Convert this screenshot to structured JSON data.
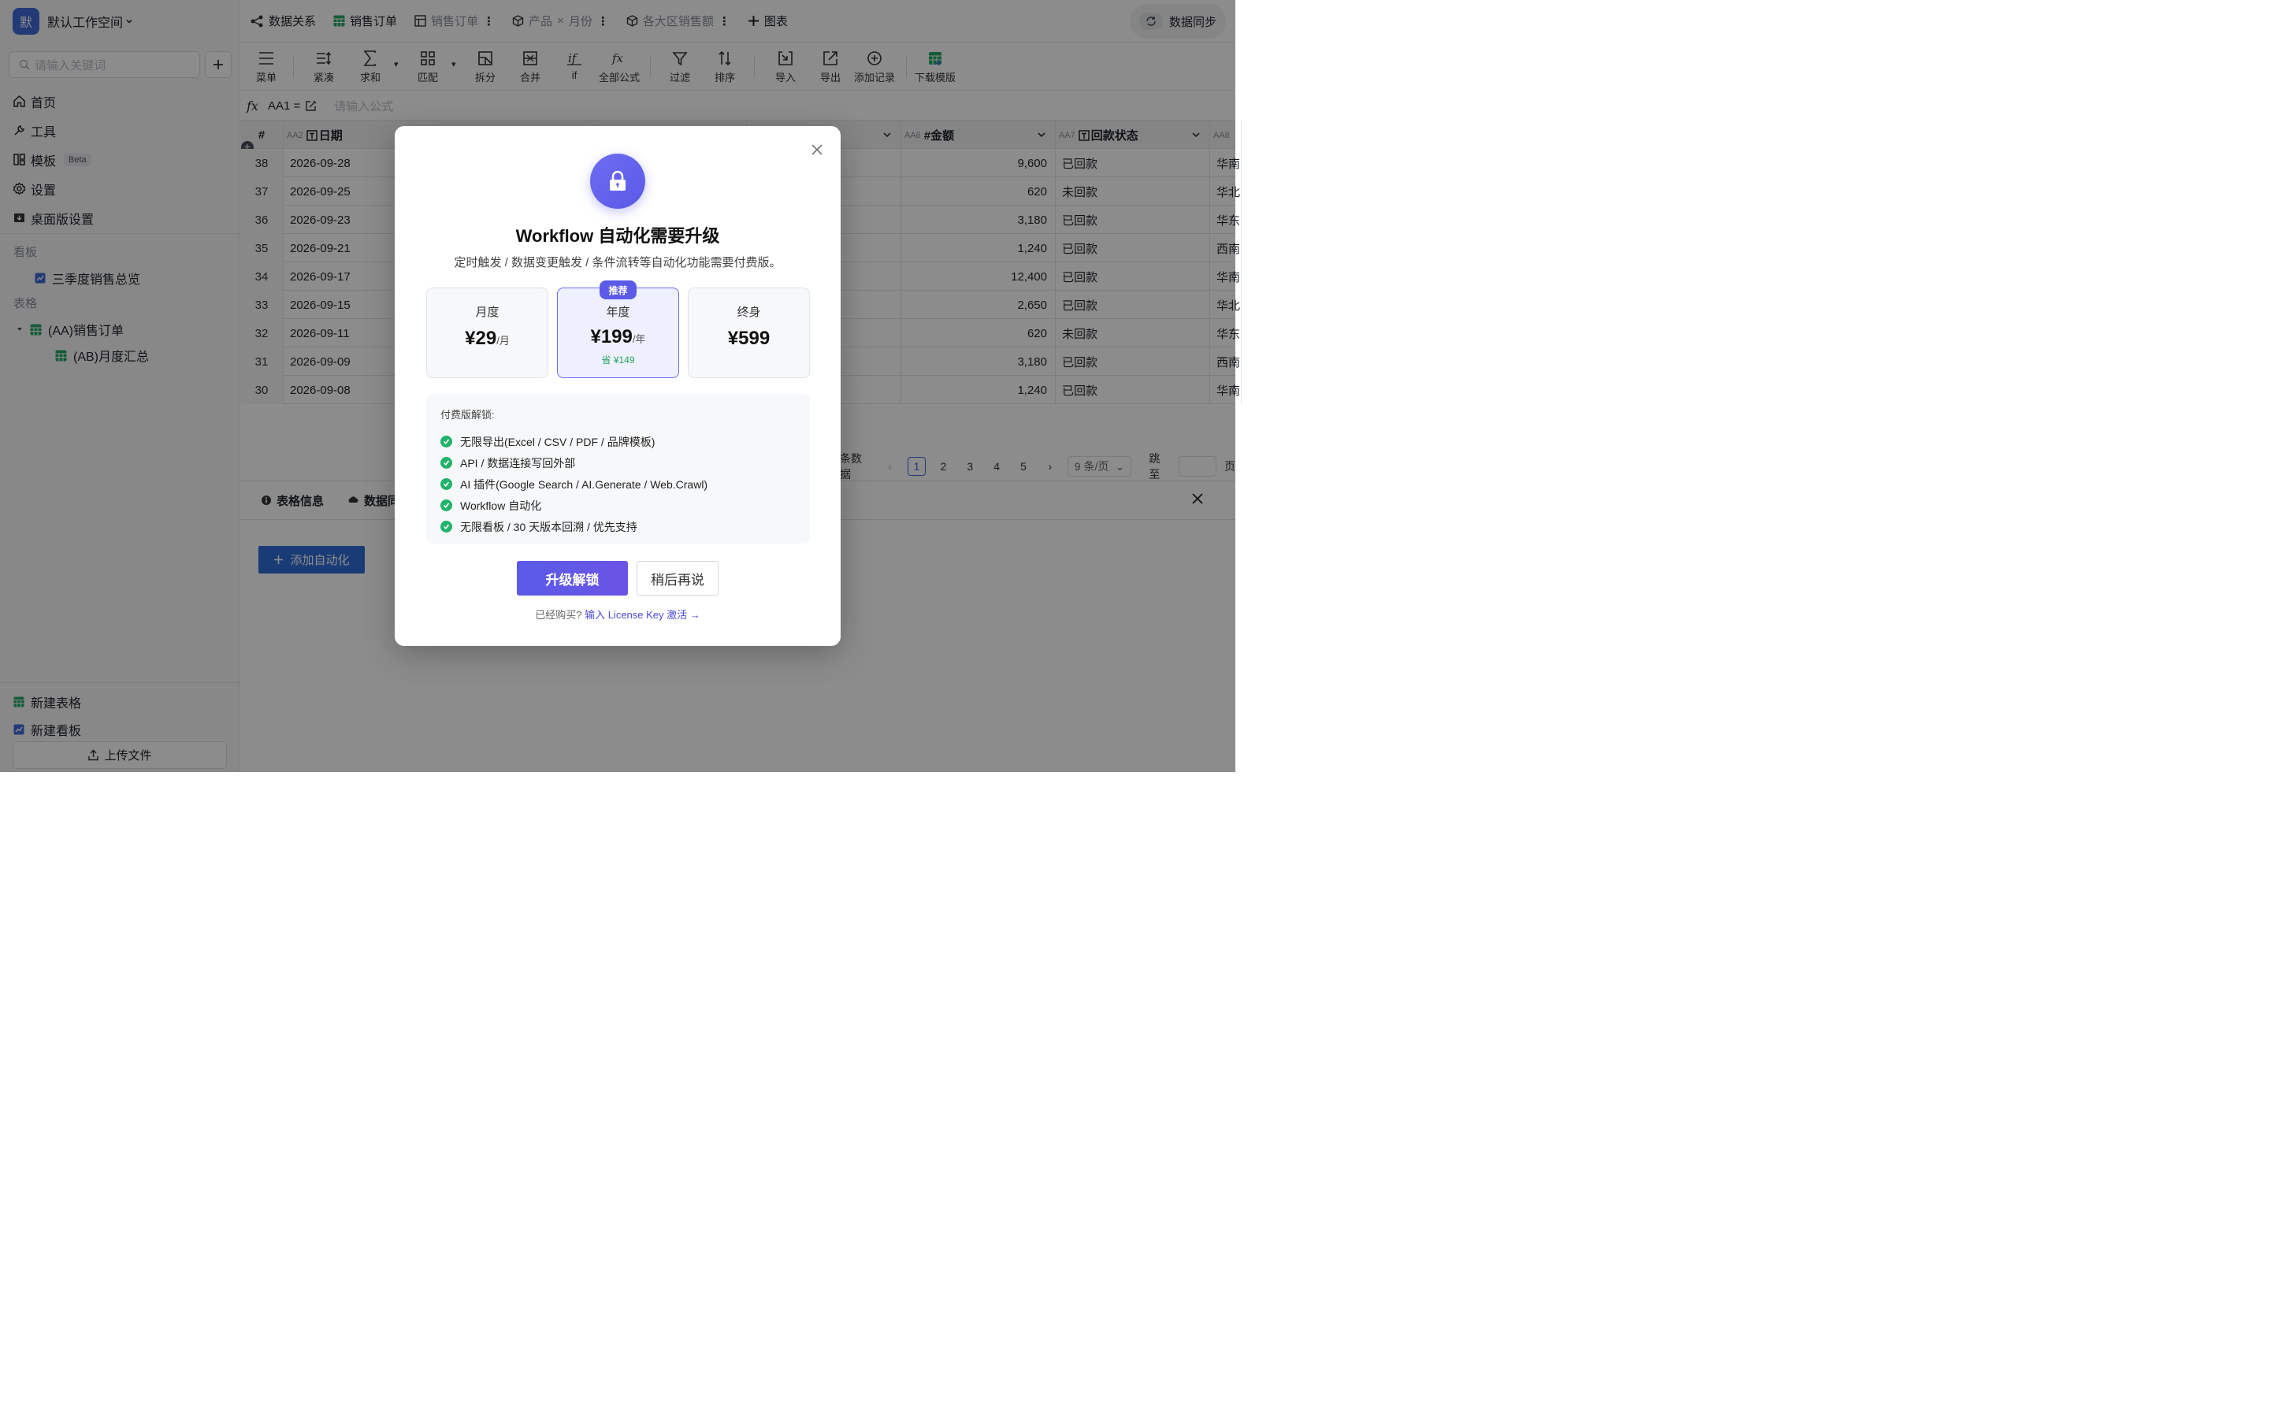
{
  "workspace": {
    "avatar": "默",
    "name": "默认工作空间"
  },
  "sidebar": {
    "search_placeholder": "请输入关键词",
    "nav": [
      {
        "label": "首页",
        "icon": "home-icon"
      },
      {
        "label": "工具",
        "icon": "wrench-icon"
      },
      {
        "label": "模板",
        "icon": "template-icon",
        "badge": "Beta"
      },
      {
        "label": "设置",
        "icon": "gear-icon"
      },
      {
        "label": "桌面版设置",
        "icon": "desktop-icon"
      }
    ],
    "board_section": "看板",
    "board_item": "三季度销售总览",
    "table_section": "表格",
    "table_item": "(AA)销售订单",
    "table_subitem": "(AB)月度汇总",
    "new_table": "新建表格",
    "new_board": "新建看板",
    "upload": "上传文件"
  },
  "tabs": {
    "items": [
      "数据关系",
      "销售订单",
      "销售订单",
      "产品",
      "×",
      "月份",
      "各大区销售额",
      "图表"
    ],
    "sync": "数据同步"
  },
  "toolbar": [
    "菜单",
    "紧凑",
    "求和",
    "匹配",
    "拆分",
    "合并",
    "if",
    "全部公式",
    "过滤",
    "排序",
    "导入",
    "导出",
    "添加记录",
    "下载模版"
  ],
  "formula": {
    "cell": "AA1 =",
    "placeholder": "请输入公式",
    "icon": "fx"
  },
  "grid": {
    "header": {
      "num": "#",
      "c1_code": "AA2",
      "c1": "日期",
      "c6_code": "AA6",
      "c6": "#金额",
      "c7_code": "AA7",
      "c7": "回款状态",
      "c8_code": "AA8"
    },
    "rows": [
      {
        "n": "38",
        "date": "2026-09-28",
        "amount": "9,600",
        "status": "已回款",
        "region": "华南"
      },
      {
        "n": "37",
        "date": "2026-09-25",
        "amount": "620",
        "status": "未回款",
        "region": "华北"
      },
      {
        "n": "36",
        "date": "2026-09-23",
        "amount": "3,180",
        "status": "已回款",
        "region": "华东"
      },
      {
        "n": "35",
        "date": "2026-09-21",
        "amount": "1,240",
        "status": "已回款",
        "region": "西南"
      },
      {
        "n": "34",
        "date": "2026-09-17",
        "amount": "12,400",
        "status": "已回款",
        "region": "华南"
      },
      {
        "n": "33",
        "date": "2026-09-15",
        "amount": "2,650",
        "status": "已回款",
        "region": "华北"
      },
      {
        "n": "32",
        "date": "2026-09-11",
        "amount": "620",
        "status": "未回款",
        "region": "华东"
      },
      {
        "n": "31",
        "date": "2026-09-09",
        "amount": "3,180",
        "status": "已回款",
        "region": "西南"
      },
      {
        "n": "30",
        "date": "2026-09-08",
        "amount": "1,240",
        "status": "已回款",
        "region": "华南"
      }
    ]
  },
  "pager": {
    "total_suffix": "条数据",
    "pages": [
      "1",
      "2",
      "3",
      "4",
      "5"
    ],
    "active": "1",
    "size": "9 条/页",
    "jump": "跳至",
    "page_unit": "页"
  },
  "panel": {
    "tab1": "表格信息",
    "tab2": "数据同",
    "add_automation": "添加自动化"
  },
  "modal": {
    "title": "Workflow 自动化需要升级",
    "subtitle": "定时触发 / 数据变更触发 / 条件流转等自动化功能需要付费版。",
    "plans": [
      {
        "name": "月度",
        "price": "¥29",
        "unit": "/月"
      },
      {
        "name": "年度",
        "price": "¥199",
        "unit": "/年",
        "save": "省 ¥149",
        "badge": "推荐"
      },
      {
        "name": "终身",
        "price": "¥599"
      }
    ],
    "features_title": "付费版解锁:",
    "features": [
      "无限导出(Excel / CSV / PDF / 品牌模板)",
      "API / 数据连接写回外部",
      "AI 插件(Google Search / AI.Generate / Web.Crawl)",
      "Workflow 自动化",
      "无限看板 / 30 天版本回溯 / 优先支持"
    ],
    "primary": "升级解锁",
    "secondary": "稍后再说",
    "footer_text": "已经购买?",
    "footer_link": "输入 License Key 激活 →"
  },
  "colors": {
    "accent": "#5b5be8",
    "primary_blue": "#2f6cd8",
    "success": "#22b36a"
  }
}
